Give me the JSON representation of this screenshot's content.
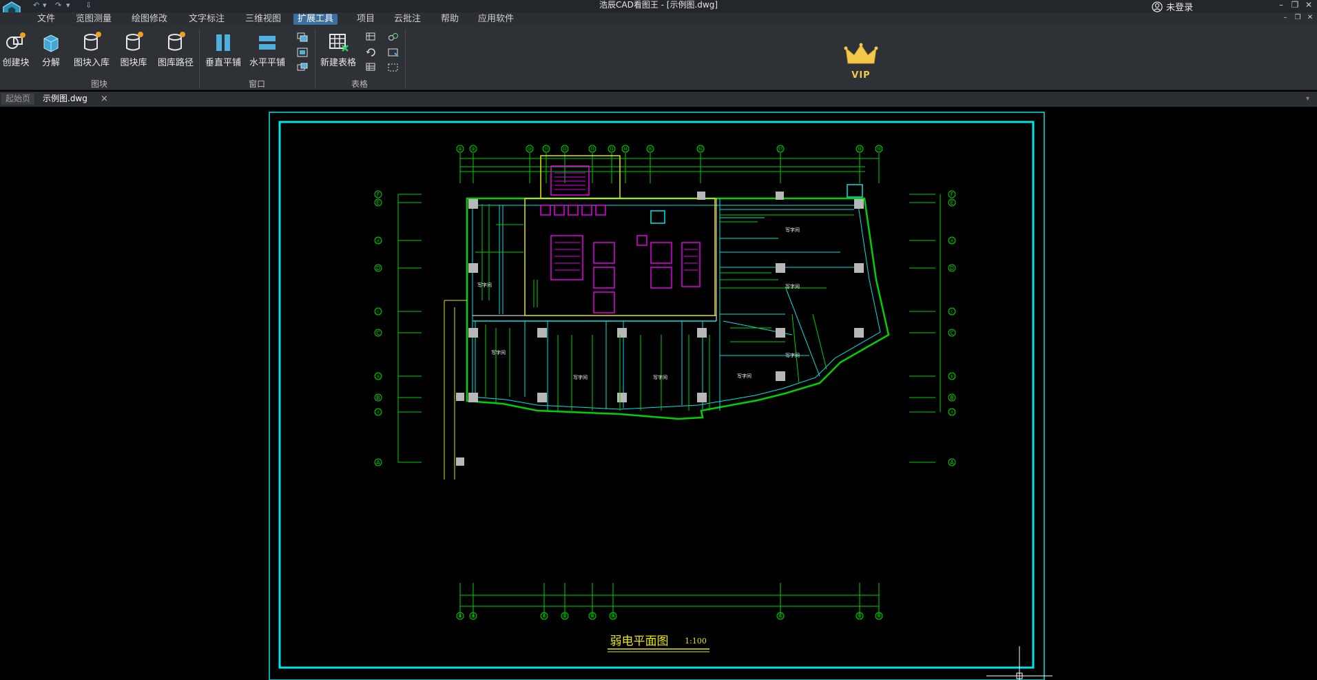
{
  "window": {
    "title": "浩辰CAD看图王 - [示例图.dwg]",
    "login_label": "未登录",
    "min": "–",
    "restore": "❐",
    "close": "✕",
    "sub_min": "–",
    "sub_restore": "❐",
    "sub_close": "✕"
  },
  "quick_access": {
    "undo": "↶",
    "undo_drop": "▾",
    "redo": "↷",
    "redo_drop": "▾",
    "custom": "⇩"
  },
  "menu": [
    "文件",
    "览图测量",
    "绘图修改",
    "文字标注",
    "三维视图",
    "扩展工具",
    "项目",
    "云批注",
    "帮助",
    "应用软件"
  ],
  "ribbon": {
    "block_group": {
      "label": "图块",
      "buttons": [
        "创建块",
        "分解",
        "图块入库",
        "图块库",
        "图库路径"
      ]
    },
    "window_group": {
      "label": "窗口",
      "buttons": [
        "垂直平铺",
        "水平平铺"
      ]
    },
    "table_group": {
      "label": "表格",
      "buttons": [
        "新建表格"
      ]
    }
  },
  "vip_label": "VIP",
  "doc_tabs": {
    "start": "起始页",
    "active": "示例图.dwg",
    "close": "×",
    "scroll": "▾"
  },
  "drawing": {
    "title": "弱电平面图",
    "scale": "1:100",
    "room_label": "写字间",
    "top_axes": [
      "⑧",
      "⑨",
      "⑩",
      "⑪",
      "⑫",
      "⑬",
      "⑬",
      "⑭",
      "⑮",
      "⑯",
      "⑰",
      "⑱",
      "⑲"
    ],
    "left_axes": [
      "F",
      "E",
      "ⓓ",
      "D",
      "ⓒ",
      "C",
      "ⓑ",
      "B",
      "ⓐ",
      "A"
    ],
    "bottom_axes": [
      "⑧",
      "⑨",
      "⑪",
      "⑫",
      "⑬",
      "⑭",
      "⑯",
      "⑰",
      "⑱",
      "⑲"
    ]
  },
  "colors": {
    "frame": "#00e5e5",
    "green": "#00d200",
    "magenta": "#e600e6",
    "yellow": "#e8e800",
    "white": "#ffffff",
    "active_tab": "#3b6fa0"
  }
}
